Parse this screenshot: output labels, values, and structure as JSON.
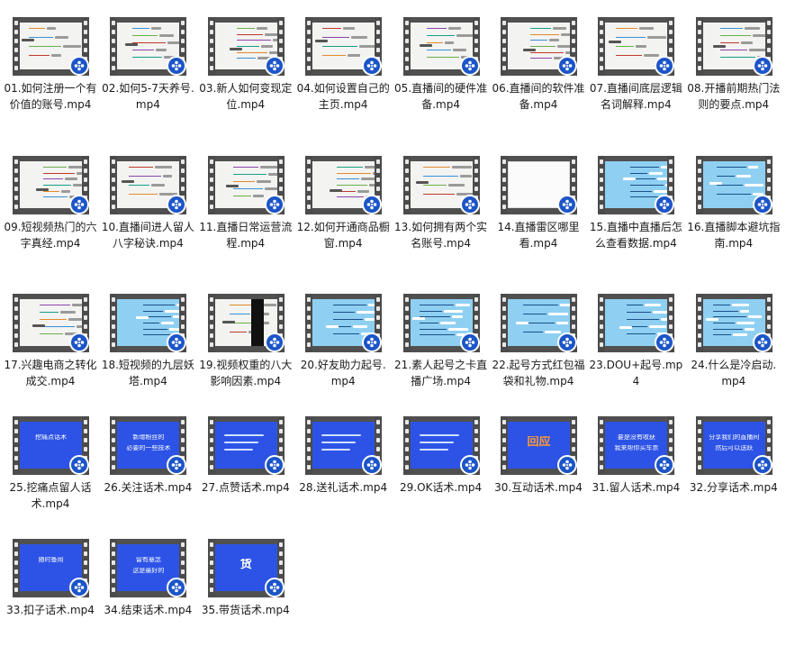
{
  "window": {
    "view": "large-icons"
  },
  "colors": {
    "mind_bg": "#f3f3f1",
    "sky_bg": "#8fd0f2",
    "blue_bg": "#2d53e6",
    "play_icon": "#1c55c8"
  },
  "files": [
    {
      "name": "01.如何注册一个有价值的账号.mp4",
      "thumb": "mind",
      "text": []
    },
    {
      "name": "02.如何5-7天养号.mp4",
      "thumb": "mind",
      "text": []
    },
    {
      "name": "03.新人如何变现定位.mp4",
      "thumb": "mind",
      "text": []
    },
    {
      "name": "04.如何设置自己的主页.mp4",
      "thumb": "mind",
      "text": []
    },
    {
      "name": "05.直播间的硬件准备.mp4",
      "thumb": "mind",
      "text": []
    },
    {
      "name": "06.直播间的软件准备.mp4",
      "thumb": "mind",
      "text": []
    },
    {
      "name": "07.直播间底层逻辑名词解释.mp4",
      "thumb": "mind",
      "text": []
    },
    {
      "name": "08.开播前期热门法则的要点.mp4",
      "thumb": "mind",
      "text": []
    },
    {
      "name": "09.短视频热门的六字真经.mp4",
      "thumb": "mind",
      "text": []
    },
    {
      "name": "10.直播间进人留人八字秘诀.mp4",
      "thumb": "mind",
      "text": []
    },
    {
      "name": "11.直播日常运营流程.mp4",
      "thumb": "mind",
      "text": []
    },
    {
      "name": "12.如何开通商品橱窗.mp4",
      "thumb": "mind",
      "text": []
    },
    {
      "name": "13.如何拥有两个实名账号.mp4",
      "thumb": "mind",
      "text": []
    },
    {
      "name": "14.直播雷区哪里看.mp4",
      "thumb": "white",
      "text": []
    },
    {
      "name": "15.直播中直播后怎么查看数据.mp4",
      "thumb": "sky",
      "text": []
    },
    {
      "name": "16.直播脚本避坑指南.mp4",
      "thumb": "sky",
      "text": []
    },
    {
      "name": "17.兴趣电商之转化成交.mp4",
      "thumb": "mind",
      "text": []
    },
    {
      "name": "18.短视频的九层妖塔.mp4",
      "thumb": "sky",
      "text": []
    },
    {
      "name": "19.视频权重的八大影响因素.mp4",
      "thumb": "mind",
      "text": []
    },
    {
      "name": "20.好友助力起号.mp4",
      "thumb": "sky",
      "text": []
    },
    {
      "name": "21.素人起号之卡直播广场.mp4",
      "thumb": "sky",
      "text": []
    },
    {
      "name": "22.起号方式红包福袋和礼物.mp4",
      "thumb": "sky",
      "text": []
    },
    {
      "name": "23.DOU+起号.mp4",
      "thumb": "sky",
      "text": []
    },
    {
      "name": "24.什么是冷启动.mp4",
      "thumb": "sky",
      "text": []
    },
    {
      "name": "25.挖痛点留人话术.mp4",
      "thumb": "blue",
      "text": [
        "挖痛点话术"
      ]
    },
    {
      "name": "26.关注话术.mp4",
      "thumb": "blue",
      "text": [
        "新增粉丝的",
        "必要的一些技术"
      ]
    },
    {
      "name": "27.点赞话术.mp4",
      "thumb": "blue",
      "text": []
    },
    {
      "name": "28.送礼话术.mp4",
      "thumb": "blue",
      "text": []
    },
    {
      "name": "29.OK话术.mp4",
      "thumb": "blue",
      "text": []
    },
    {
      "name": "30.互动话术.mp4",
      "thumb": "blue",
      "text": [
        "回应"
      ]
    },
    {
      "name": "31.留人话术.mp4",
      "thumb": "blue",
      "text": [
        "要是没有收获",
        "我来帮你买车票"
      ]
    },
    {
      "name": "32.分享话术.mp4",
      "thumb": "blue",
      "text": [
        "分享我们的直播间",
        "然后可以送跃"
      ]
    },
    {
      "name": "33.扣子话术.mp4",
      "thumb": "blue",
      "text": [
        "随时备用"
      ]
    },
    {
      "name": "34.结束话术.mp4",
      "thumb": "blue",
      "text": [
        "留有悬念",
        "这是最好的"
      ]
    },
    {
      "name": "35.带货话术.mp4",
      "thumb": "blue",
      "text": [
        "货"
      ]
    }
  ]
}
